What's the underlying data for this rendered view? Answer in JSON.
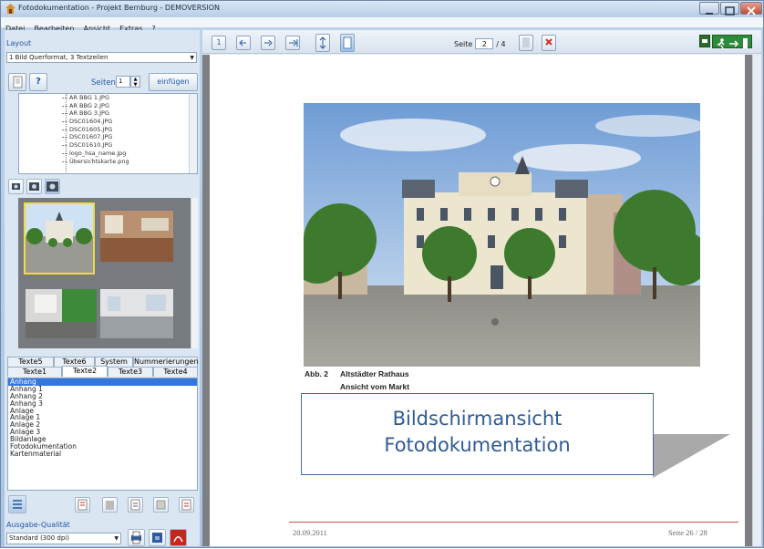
{
  "window": {
    "title": "Fotodokumentation - Projekt Bernburg - DEMOVERSION"
  },
  "menu": [
    "Datei",
    "Bearbeiten",
    "Ansicht",
    "Extras",
    "?"
  ],
  "left": {
    "layout_label": "Layout",
    "layout_select": "1 Bild Querformat, 3 Textzeilen",
    "pages_label": "Seiten",
    "pages_value": "1",
    "insert_button": "einfügen",
    "help_label": "?",
    "files": [
      "AR BBG 1.JPG",
      "AR BBG 2.JPG",
      "AR BBG 3.JPG",
      "DSC01604.JPG",
      "DSC01605.JPG",
      "DSC01607.JPG",
      "DSC01610.JPG",
      "logo_hsa_name.jpg",
      "Übersichtskarte.png"
    ],
    "tabs_row1": [
      "Texte5",
      "Texte6",
      "System",
      "Nummerierungen"
    ],
    "tabs_row2": [
      "Texte1",
      "Texte2",
      "Texte3",
      "Texte4"
    ],
    "text_items": [
      "Anhang",
      "Anhang 1",
      "Anhang 2",
      "Anhang 3",
      "Anlage",
      "Anlage 1",
      "Anlage 2",
      "Anlage 3",
      "Bildanlage",
      "Fotodokumentation",
      "Kartenmaterial"
    ],
    "quality_label": "Ausgabe-Qualität",
    "quality_select": "Standard (300 dpi)"
  },
  "toolbar": {
    "page_label": "Seite",
    "page_current": "2",
    "page_total": "/ 4"
  },
  "document": {
    "caption_num": "Abb. 2",
    "caption_line1": "Altstädter Rathaus",
    "caption_line2": "Ansicht vom Markt",
    "callout_line1": "Bildschirmansicht",
    "callout_line2": "Fotodokumentation",
    "footer_date": "20.09.2011",
    "footer_page": "Seite 26 / 28"
  },
  "colors": {
    "accent": "#3377dd",
    "callout": "#2f5b94",
    "pdf_red": "#c8261c"
  }
}
